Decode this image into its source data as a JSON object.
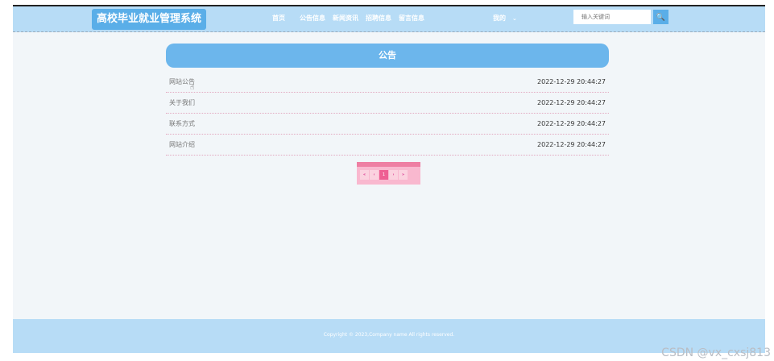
{
  "header": {
    "logo": "高校毕业就业管理系统",
    "nav": [
      "首页",
      "公告信息",
      "新闻资讯",
      "招聘信息",
      "留言信息"
    ],
    "user_menu": "我的",
    "search_placeholder": "输入关键词"
  },
  "main": {
    "title": "公告",
    "items": [
      {
        "title": "网站公告",
        "date": "2022-12-29 20:44:27"
      },
      {
        "title": "关于我们",
        "date": "2022-12-29 20:44:27"
      },
      {
        "title": "联系方式",
        "date": "2022-12-29 20:44:27"
      },
      {
        "title": "网站介绍",
        "date": "2022-12-29 20:44:27"
      }
    ],
    "pagination": {
      "first": "«",
      "prev": "‹",
      "current": "1",
      "next": "›",
      "last": "»"
    }
  },
  "footer": {
    "copyright": "Copyright © 2023,Company name All rights reserved."
  },
  "watermark": "CSDN @vx_cxsj813"
}
